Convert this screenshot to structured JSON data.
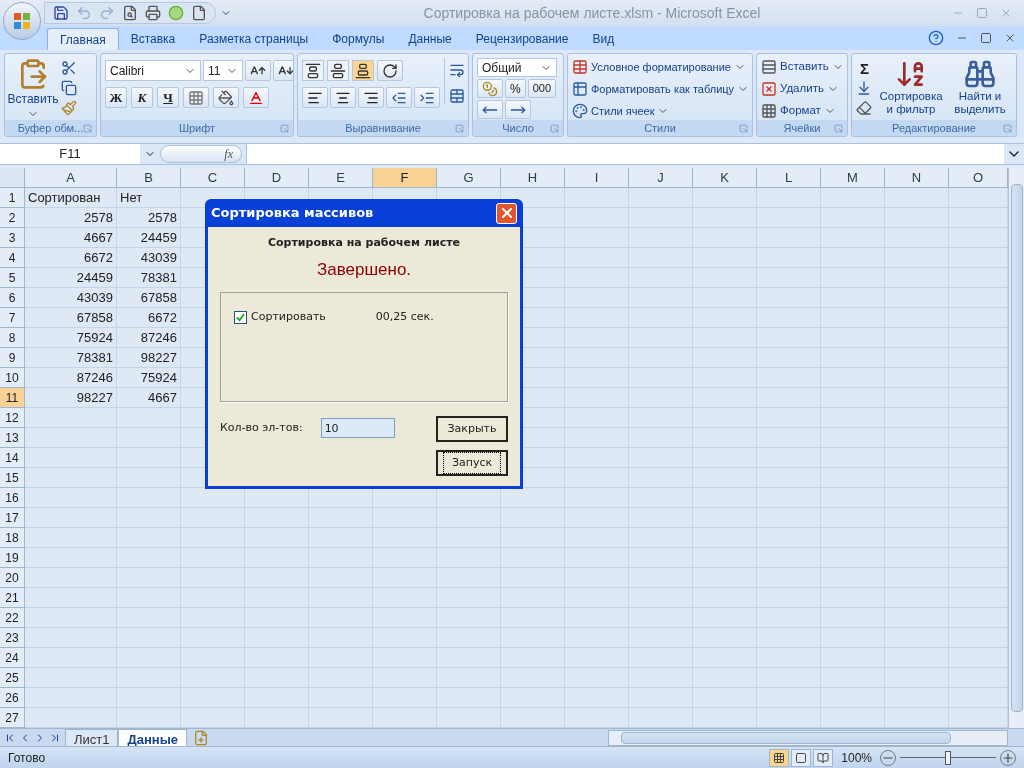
{
  "window": {
    "title": "Сортировка на рабочем листе.xlsm - Microsoft Excel"
  },
  "ribbon_tabs": [
    {
      "label": "Главная",
      "selected": true
    },
    {
      "label": "Вставка",
      "selected": false
    },
    {
      "label": "Разметка страницы",
      "selected": false
    },
    {
      "label": "Формулы",
      "selected": false
    },
    {
      "label": "Данные",
      "selected": false
    },
    {
      "label": "Рецензирование",
      "selected": false
    },
    {
      "label": "Вид",
      "selected": false
    }
  ],
  "ribbon": {
    "clipboard": {
      "paste": "Вставить",
      "label": "Буфер обм..."
    },
    "font": {
      "name": "Calibri",
      "size": "11",
      "bold": "Ж",
      "italic": "К",
      "underline": "Ч",
      "label": "Шрифт"
    },
    "alignment": {
      "vertical": [
        {
          "selected": false
        },
        {
          "selected": false
        },
        {
          "selected": true
        }
      ],
      "label": "Выравнивание"
    },
    "number": {
      "format": "Общий",
      "percent": "%",
      "thousands": "000",
      "label": "Число"
    },
    "styles": {
      "items": [
        "Условное форматирование",
        "Форматировать как таблицу",
        "Стили ячеек"
      ],
      "label": "Стили"
    },
    "cells": {
      "items": [
        "Вставить",
        "Удалить",
        "Формат"
      ],
      "label": "Ячейки"
    },
    "editing": {
      "sigma": "Σ",
      "sort": "Сортировка и фильтр",
      "find": "Найти и выделить",
      "label": "Редактирование"
    }
  },
  "formula_bar": {
    "name_box": "F11",
    "fx": "fx"
  },
  "sheet": {
    "columns": [
      {
        "label": "A",
        "selected": false
      },
      {
        "label": "B",
        "selected": false
      },
      {
        "label": "C",
        "selected": false
      },
      {
        "label": "D",
        "selected": false
      },
      {
        "label": "E",
        "selected": false
      },
      {
        "label": "F",
        "selected": true
      },
      {
        "label": "G",
        "selected": false
      },
      {
        "label": "H",
        "selected": false
      },
      {
        "label": "I",
        "selected": false
      },
      {
        "label": "J",
        "selected": false
      },
      {
        "label": "K",
        "selected": false
      },
      {
        "label": "L",
        "selected": false
      },
      {
        "label": "M",
        "selected": false
      },
      {
        "label": "N",
        "selected": false
      },
      {
        "label": "O",
        "selected": false
      }
    ],
    "rows": [
      {
        "number": "1",
        "selected": false,
        "kind": "text",
        "cells": [
          "Сортирован",
          "Нет"
        ]
      },
      {
        "number": "2",
        "selected": false,
        "kind": "number",
        "cells": [
          "2578",
          "2578"
        ]
      },
      {
        "number": "3",
        "selected": false,
        "kind": "number",
        "cells": [
          "4667",
          "24459"
        ]
      },
      {
        "number": "4",
        "selected": false,
        "kind": "number",
        "cells": [
          "6672",
          "43039"
        ]
      },
      {
        "number": "5",
        "selected": false,
        "kind": "number",
        "cells": [
          "24459",
          "78381"
        ]
      },
      {
        "number": "6",
        "selected": false,
        "kind": "number",
        "cells": [
          "43039",
          "67858"
        ]
      },
      {
        "number": "7",
        "selected": false,
        "kind": "number",
        "cells": [
          "67858",
          "6672"
        ]
      },
      {
        "number": "8",
        "selected": false,
        "kind": "number",
        "cells": [
          "75924",
          "87246"
        ]
      },
      {
        "number": "9",
        "selected": false,
        "kind": "number",
        "cells": [
          "78381",
          "98227"
        ]
      },
      {
        "number": "10",
        "selected": false,
        "kind": "number",
        "cells": [
          "87246",
          "75924"
        ]
      },
      {
        "number": "11",
        "selected": true,
        "kind": "number",
        "cells": [
          "98227",
          "4667"
        ]
      },
      {
        "number": "12",
        "selected": false
      },
      {
        "number": "13",
        "selected": false
      },
      {
        "number": "14",
        "selected": false
      },
      {
        "number": "15",
        "selected": false
      },
      {
        "number": "16",
        "selected": false
      },
      {
        "number": "17",
        "selected": false
      },
      {
        "number": "18",
        "selected": false
      },
      {
        "number": "19",
        "selected": false
      },
      {
        "number": "20",
        "selected": false
      },
      {
        "number": "21",
        "selected": false
      },
      {
        "number": "22",
        "selected": false
      },
      {
        "number": "23",
        "selected": false
      },
      {
        "number": "24",
        "selected": false
      },
      {
        "number": "25",
        "selected": false
      },
      {
        "number": "26",
        "selected": false
      },
      {
        "number": "27",
        "selected": false
      }
    ]
  },
  "dialog": {
    "title": "Сортировка массивов",
    "heading": "Сортировка на рабочем листе",
    "status": "Завершено.",
    "checkbox": {
      "label": "Сортировать",
      "checked": true
    },
    "time": "00,25 сек.",
    "count_label": "Кол-во эл-тов:",
    "count": "10",
    "buttons": [
      {
        "label": "Закрыть",
        "focused": false
      },
      {
        "label": "Запуск",
        "focused": true
      }
    ]
  },
  "sheet_tabs": [
    {
      "label": "Лист1",
      "selected": false
    },
    {
      "label": "Данные",
      "selected": true
    }
  ],
  "status_bar": {
    "text": "Готово",
    "views": [
      {
        "selected": true
      },
      {
        "selected": false
      },
      {
        "selected": false
      }
    ],
    "zoom": "100%",
    "zoom_slider": {
      "level": 0.5
    }
  }
}
